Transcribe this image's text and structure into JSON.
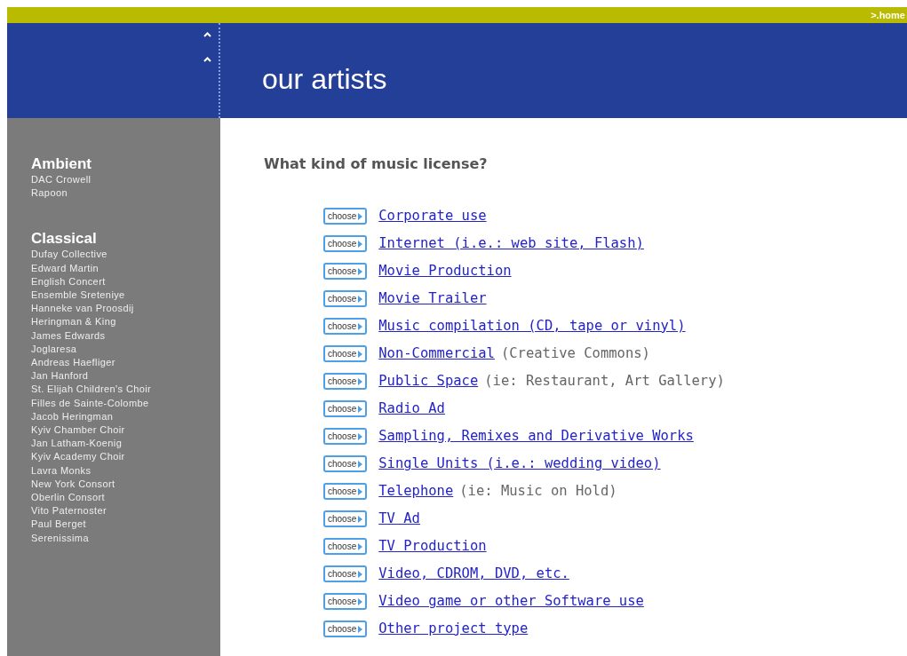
{
  "top_bar": {
    "home_link": ">.home"
  },
  "header": {
    "title": "our artists"
  },
  "sidebar": {
    "genres": [
      {
        "name": "Ambient",
        "artists": [
          "DAC Crowell",
          "Rapoon"
        ]
      },
      {
        "name": "Classical",
        "artists": [
          "Dufay Collective",
          "Edward Martin",
          "English Concert",
          "Ensemble Sreteniye",
          "Hanneke van Proosdij",
          "Heringman & King",
          "James Edwards",
          "Joglaresa",
          "Andreas Haefliger",
          "Jan Hanford",
          "St. Elijah Children's Choir",
          "Filles de Sainte-Colombe",
          "Jacob Heringman",
          "Kyiv Chamber Choir",
          "Jan Latham-Koenig",
          "Kyiv Academy Choir",
          "Lavra Monks",
          "New York Consort",
          "Oberlin Consort",
          "Vito Paternoster",
          "Paul Berget",
          "Serenissima"
        ]
      }
    ]
  },
  "main": {
    "question": "What kind of music license?",
    "options": [
      {
        "button": "choose",
        "link": "Corporate use"
      },
      {
        "button": "choose",
        "link": "Internet (i.e.: web site, Flash)"
      },
      {
        "button": "choose",
        "link": "Movie Production"
      },
      {
        "button": "choose",
        "link": "Movie Trailer"
      },
      {
        "button": "choose",
        "link": "Music compilation (CD, tape or vinyl)"
      },
      {
        "button": "choose",
        "link": "Non-Commercial",
        "note": "(Creative Commons)"
      },
      {
        "button": "choose",
        "link": "Public Space",
        "note": "(ie: Restaurant, Art Gallery)"
      },
      {
        "button": "choose",
        "link": "Radio Ad"
      },
      {
        "button": "choose",
        "link": "Sampling, Remixes and Derivative Works"
      },
      {
        "button": "choose",
        "link": "Single Units (i.e.: wedding video)"
      },
      {
        "button": "choose",
        "link": "Telephone",
        "note": "(ie: Music on Hold)"
      },
      {
        "button": "choose",
        "link": "TV Ad"
      },
      {
        "button": "choose",
        "link": "TV Production"
      },
      {
        "button": "choose",
        "link": "Video, CDROM, DVD, etc."
      },
      {
        "button": "choose",
        "link": "Video game or other Software use"
      },
      {
        "button": "choose",
        "link": "Other project type"
      }
    ]
  }
}
